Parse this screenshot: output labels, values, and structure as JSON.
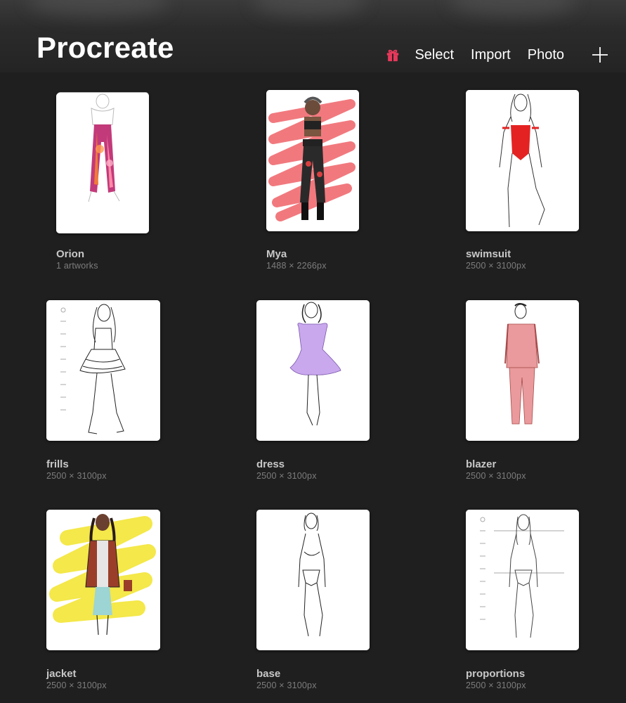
{
  "app": {
    "title": "Procreate"
  },
  "toolbar": {
    "gift_icon": "gift-icon",
    "select_label": "Select",
    "import_label": "Import",
    "photo_label": "Photo",
    "add_icon": "plus-icon"
  },
  "colors": {
    "background": "#1f1f1f",
    "accent_gift": "#e8395c",
    "title_text": "#ffffff",
    "tile_name_text": "#c8c8c8",
    "tile_meta_text": "#7d7d7d"
  },
  "gallery": [
    {
      "name": "Orion",
      "meta": "1 artworks",
      "kind": "stack"
    },
    {
      "name": "Mya",
      "meta": "1488 × 2266px",
      "kind": "artwork"
    },
    {
      "name": "swimsuit",
      "meta": "2500 × 3100px",
      "kind": "artwork"
    },
    {
      "name": "frills",
      "meta": "2500 × 3100px",
      "kind": "artwork"
    },
    {
      "name": "dress",
      "meta": "2500 × 3100px",
      "kind": "artwork"
    },
    {
      "name": "blazer",
      "meta": "2500 × 3100px",
      "kind": "artwork"
    },
    {
      "name": "jacket",
      "meta": "2500 × 3100px",
      "kind": "artwork"
    },
    {
      "name": "base",
      "meta": "2500 × 3100px",
      "kind": "artwork"
    },
    {
      "name": "proportions",
      "meta": "2500 × 3100px",
      "kind": "artwork"
    }
  ]
}
